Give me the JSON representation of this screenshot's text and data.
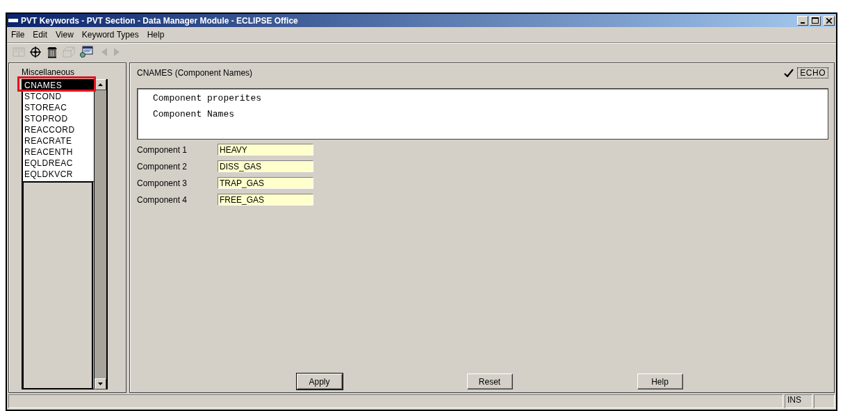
{
  "window": {
    "title": "PVT Keywords - PVT Section - Data Manager Module - ECLIPSE Office"
  },
  "menu": [
    "File",
    "Edit",
    "View",
    "Keyword Types",
    "Help"
  ],
  "toolbar": [
    {
      "kind": "book",
      "disabled": true
    },
    {
      "kind": "target",
      "disabled": false
    },
    {
      "kind": "bin",
      "disabled": false
    },
    {
      "kind": "cube",
      "disabled": true
    },
    {
      "kind": "screen",
      "disabled": false
    },
    {
      "kind": "back",
      "disabled": true
    },
    {
      "kind": "forward",
      "disabled": true
    }
  ],
  "sidebar": {
    "heading": "Miscellaneous",
    "items": [
      {
        "label": "CNAMES",
        "selected": true
      },
      {
        "label": "STCOND",
        "selected": false
      },
      {
        "label": "STOREAC",
        "selected": false
      },
      {
        "label": "STOPROD",
        "selected": false
      },
      {
        "label": "REACCORD",
        "selected": false
      },
      {
        "label": "REACRATE",
        "selected": false
      },
      {
        "label": "REACENTH",
        "selected": false
      },
      {
        "label": "EQLDREAC",
        "selected": false
      },
      {
        "label": "EQLDKVCR",
        "selected": false
      }
    ]
  },
  "panel": {
    "title": "CNAMES (Component Names)",
    "echo": {
      "label": "ECHO",
      "checked": true
    },
    "description": [
      "Component properites",
      "Component Names"
    ],
    "fields": [
      {
        "label": "Component 1",
        "value": "HEAVY"
      },
      {
        "label": "Component 2",
        "value": "DISS_GAS"
      },
      {
        "label": "Component 3",
        "value": "TRAP_GAS"
      },
      {
        "label": "Component 4",
        "value": "FREE_GAS"
      }
    ],
    "buttons": [
      "Apply",
      "Reset",
      "Help"
    ]
  },
  "status_bar": {
    "mode": "INS"
  }
}
